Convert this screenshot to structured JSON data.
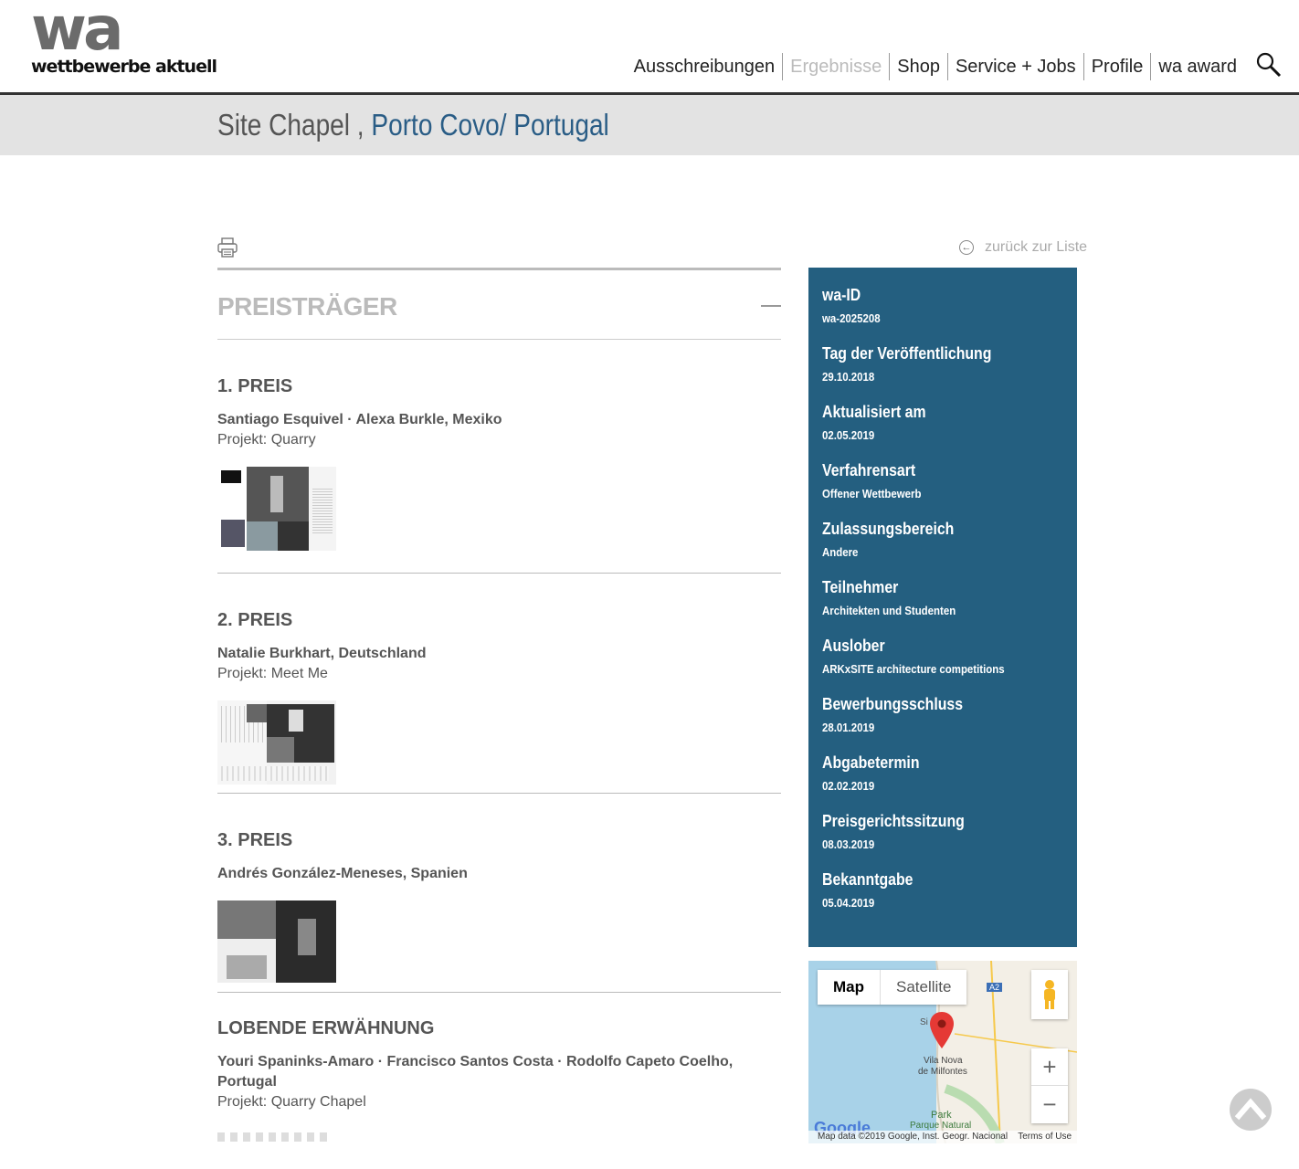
{
  "logo": {
    "mark": "wa",
    "subtitle": "wettbewerbe aktuell"
  },
  "nav": [
    {
      "label": "Ausschreibungen",
      "active": false
    },
    {
      "label": "Ergebnisse",
      "active": true
    },
    {
      "label": "Shop",
      "active": false
    },
    {
      "label": "Service + Jobs",
      "active": false
    },
    {
      "label": "Profile",
      "active": false
    },
    {
      "label": "wa award",
      "active": false
    }
  ],
  "title": {
    "name": "Site Chapel",
    "separator": " , ",
    "location": "Porto Covo/ Portugal"
  },
  "back_link": "zurück zur Liste",
  "section_title": "PREISTRÄGER",
  "prizes": [
    {
      "rank": "1. PREIS",
      "names": "Santiago Esquivel · Alexa Burkle, Mexiko",
      "project_label": "Projekt:",
      "project": "Quarry"
    },
    {
      "rank": "2. PREIS",
      "names": "Natalie Burkhart, Deutschland",
      "project_label": "Projekt:",
      "project": "Meet Me"
    },
    {
      "rank": "3. PREIS",
      "names": "Andrés González-Meneses, Spanien",
      "project_label": "",
      "project": ""
    },
    {
      "rank": "LOBENDE ERWÄHNUNG",
      "names": "Youri Spaninks-Amaro · Francisco Santos Costa · Rodolfo Capeto Coelho, Portugal",
      "project_label": "Projekt:",
      "project": "Quarry Chapel"
    }
  ],
  "sidebar": [
    {
      "label": "wa-ID",
      "value": "wa-2025208"
    },
    {
      "label": "Tag der Veröffentlichung",
      "value": "29.10.2018"
    },
    {
      "label": "Aktualisiert am",
      "value": "02.05.2019"
    },
    {
      "label": "Verfahrensart",
      "value": "Offener Wettbewerb"
    },
    {
      "label": "Zulassungsbereich",
      "value": "Andere"
    },
    {
      "label": "Teilnehmer",
      "value": "Architekten und Studenten"
    },
    {
      "label": "Auslober",
      "value": "ARKxSITE architecture competitions"
    },
    {
      "label": "Bewerbungsschluss",
      "value": "28.01.2019"
    },
    {
      "label": "Abgabetermin",
      "value": "02.02.2019"
    },
    {
      "label": "Preisgerichtssitzung",
      "value": "08.03.2019"
    },
    {
      "label": "Bekanntgabe",
      "value": "05.04.2019"
    }
  ],
  "map": {
    "tab_map": "Map",
    "tab_satellite": "Satellite",
    "place1": "Vila Nova",
    "place2": "de Milfontes",
    "place3": "Park",
    "place4": "Parque Natural",
    "place5": "Si",
    "road": "A2",
    "zoom_in": "+",
    "zoom_out": "−",
    "attribution": "Map data ©2019 Google, Inst. Geogr. Nacional",
    "terms": "Terms of Use",
    "google": "Google"
  },
  "colors": {
    "sidebar_bg": "#245f80",
    "location": "#2a5d86",
    "active_nav": "#bbbbbb"
  }
}
